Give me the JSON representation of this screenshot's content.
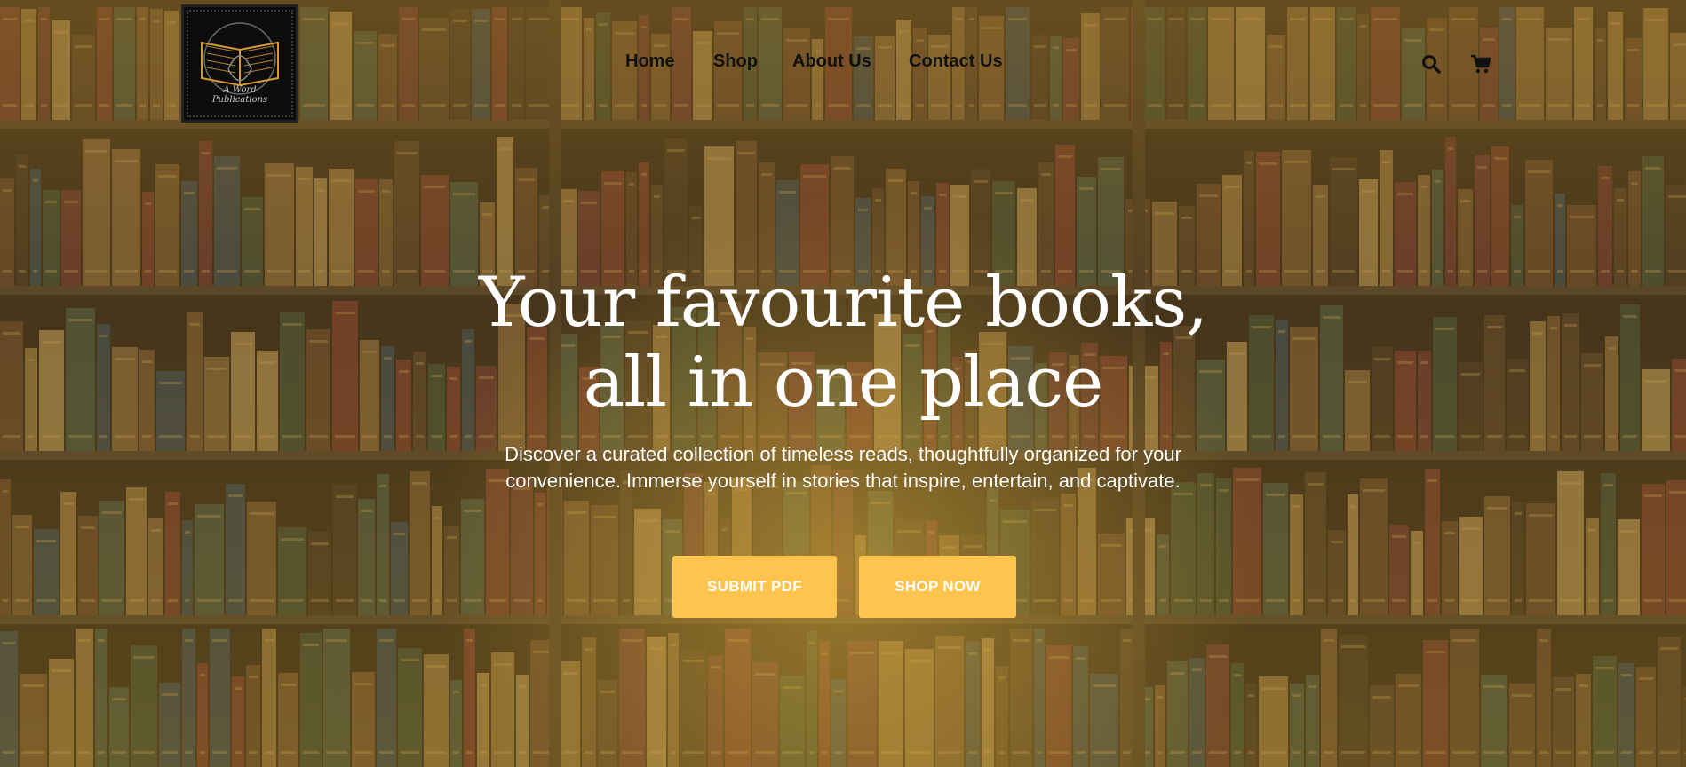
{
  "header": {
    "logo": {
      "text_line1": "A Word",
      "text_line2": "Publications"
    },
    "nav": [
      {
        "label": "Home"
      },
      {
        "label": "Shop"
      },
      {
        "label": "About Us"
      },
      {
        "label": "Contact Us"
      }
    ],
    "icons": [
      "search-icon",
      "cart-icon"
    ]
  },
  "hero": {
    "headline_line1": "Your favourite books,",
    "headline_line2": "all in one place",
    "subtext": "Discover a curated collection of timeless reads, thoughtfully organized for your convenience. Immerse yourself in stories that inspire, entertain, and captivate.",
    "buttons": {
      "submit_label": "SUBMIT PDF",
      "shop_label": "SHOP NOW"
    }
  },
  "colors": {
    "accent": "#ffc44d",
    "overlay_gold": "#d6aa3c",
    "text_light": "#ffffff",
    "nav_text": "#111111"
  }
}
